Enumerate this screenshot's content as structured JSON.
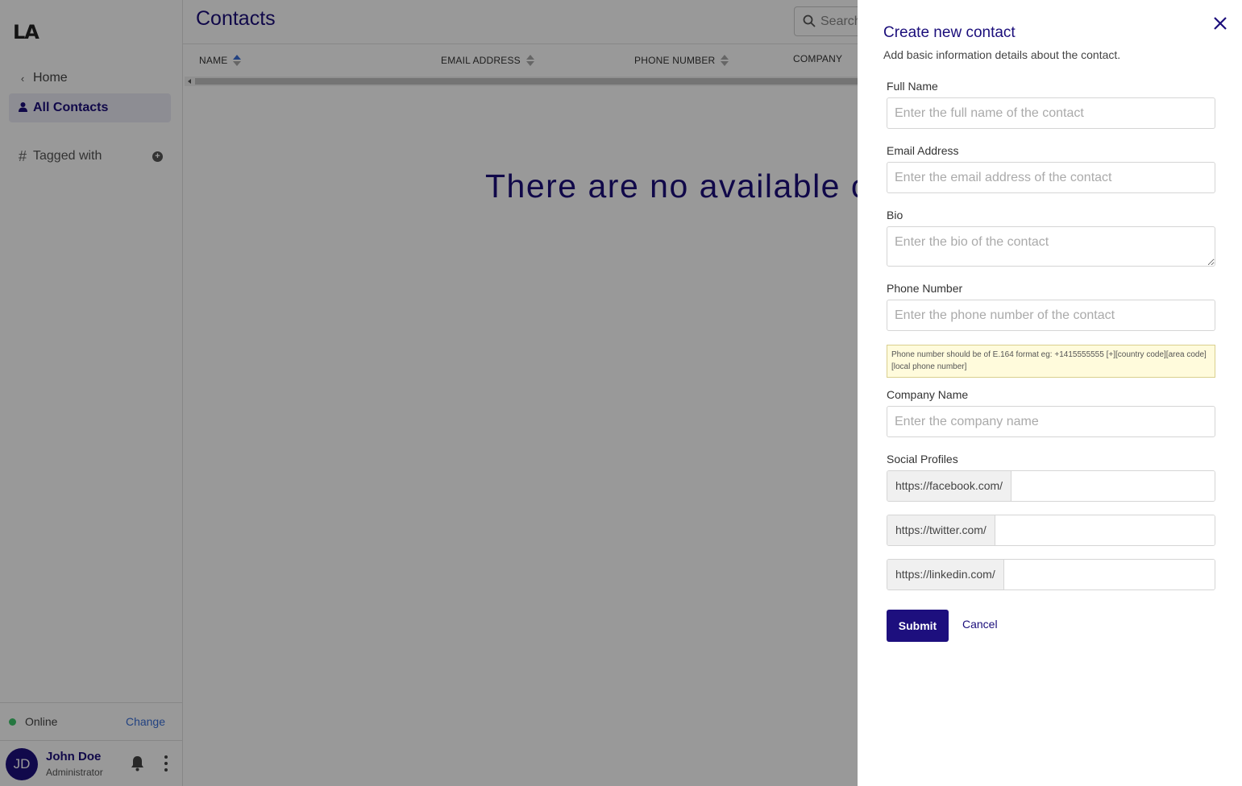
{
  "sidebar": {
    "logo": "LA",
    "nav": {
      "home": "Home",
      "all_contacts": "All Contacts",
      "tagged_with": "Tagged with"
    },
    "status": {
      "label": "Online",
      "change": "Change",
      "color": "#3ec66c"
    },
    "user": {
      "initials": "JD",
      "name": "John Doe",
      "role": "Administrator"
    }
  },
  "main": {
    "title": "Contacts",
    "search": {
      "placeholder": "Search"
    },
    "columns": [
      "NAME",
      "EMAIL ADDRESS",
      "PHONE NUMBER",
      "COMPANY"
    ],
    "empty_message": "There are no available cor"
  },
  "pane": {
    "title": "Create new contact",
    "subtitle": "Add basic information details about the contact.",
    "full_name": {
      "label": "Full Name",
      "placeholder": "Enter the full name of the contact"
    },
    "email": {
      "label": "Email Address",
      "placeholder": "Enter the email address of the contact"
    },
    "bio": {
      "label": "Bio",
      "placeholder": "Enter the bio of the contact"
    },
    "phone": {
      "label": "Phone Number",
      "placeholder": "Enter the phone number of the contact",
      "hint": "Phone number should be of E.164 format eg: +1415555555 [+][country code][area code][local phone number]"
    },
    "company": {
      "label": "Company Name",
      "placeholder": "Enter the company name"
    },
    "social": {
      "label": "Social Profiles",
      "facebook": "https://facebook.com/",
      "twitter": "https://twitter.com/",
      "linkedin": "https://linkedin.com/"
    },
    "submit": "Submit",
    "cancel": "Cancel"
  },
  "colors": {
    "brand": "#1d0f7e",
    "link": "#3a6fd8"
  }
}
